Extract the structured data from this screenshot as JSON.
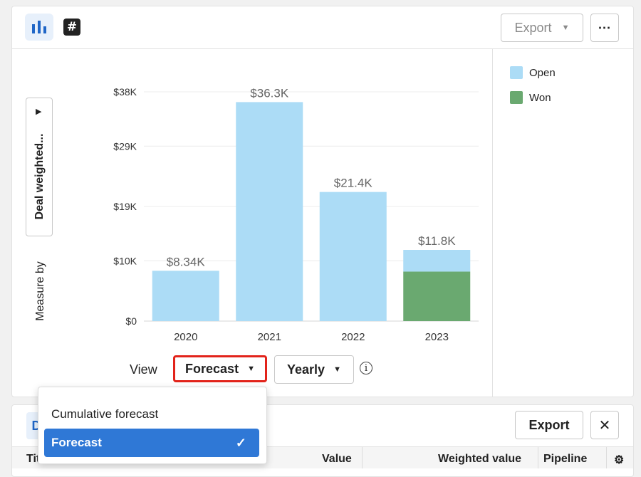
{
  "toolbar": {
    "export_label": "Export",
    "more_label": "⋯"
  },
  "measure": {
    "selected": "Deal weighted...",
    "label": "Measure by"
  },
  "legend": [
    {
      "label": "Open",
      "color": "#acdcf6"
    },
    {
      "label": "Won",
      "color": "#6aa970"
    }
  ],
  "chart_data": {
    "type": "bar",
    "stacked": true,
    "categories": [
      "2020",
      "2021",
      "2022",
      "2023"
    ],
    "series": [
      {
        "name": "Won",
        "color": "#6aa970",
        "values": [
          0,
          0,
          0,
          8.2
        ]
      },
      {
        "name": "Open",
        "color": "#acdcf6",
        "values": [
          8.34,
          36.3,
          21.4,
          3.6
        ]
      }
    ],
    "totals_labels": [
      "$8.34K",
      "$36.3K",
      "$21.4K",
      "$11.8K"
    ],
    "totals": [
      8.34,
      36.3,
      21.4,
      11.8
    ],
    "y_ticks": [
      0,
      10,
      19,
      29,
      38
    ],
    "y_tick_labels": [
      "$0",
      "$10K",
      "$19K",
      "$29K",
      "$38K"
    ],
    "ylim": [
      0,
      38
    ],
    "grid": true
  },
  "view": {
    "label": "View",
    "mode": "Forecast",
    "period": "Yearly",
    "info": "i"
  },
  "dropdown": {
    "options": [
      "Cumulative forecast",
      "Forecast"
    ],
    "selected": "Forecast",
    "check": "✓"
  },
  "bottom": {
    "tab_letter": "D",
    "export_label": "Export",
    "close_icon": "✕",
    "columns": [
      "Tit",
      "Value",
      "Weighted value",
      "Pipeline"
    ],
    "settings_icon": "⚙"
  }
}
